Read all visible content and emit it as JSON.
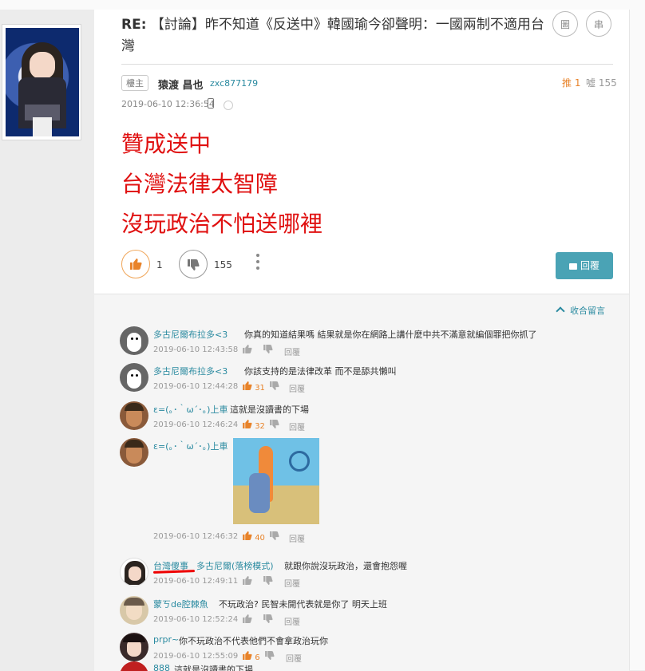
{
  "post": {
    "title_prefix": "RE:",
    "title_text": "【討論】昨不知道《反送中》韓國瑜今卻聲明：一國兩制不適用台灣",
    "image_button": "圖",
    "thread_button": "串",
    "floor_tag": "樓主",
    "author_name": "猿渡 昌也",
    "author_id": "zxc877179",
    "push_label": "推 1",
    "boo_label": "噓 155",
    "time": "2019-06-10 12:36:54",
    "body_lines": [
      "贊成送中",
      "台灣法律太智障",
      "沒玩政治不怕送哪裡"
    ],
    "upvotes": "1",
    "downvotes": "155",
    "reply_button": "回覆"
  },
  "comments_section": {
    "collapse_label": "收合留言",
    "reply_label": "回覆",
    "comments": [
      {
        "user": "多古尼爾布拉多<3",
        "text": "你真的知道結果嗎 結果就是你在網路上講什麼中共不滿意就編個罪把你抓了",
        "time": "2019-06-10 12:43:58",
        "likes": ""
      },
      {
        "user": "多古尼爾布拉多<3",
        "text": "你該支持的是法律改革 而不是舔共懶叫",
        "time": "2019-06-10 12:44:28",
        "likes": "31"
      },
      {
        "user": "ε=(｡･｀ω´･｡)上車",
        "text": "這就是沒讀書的下場",
        "time": "2019-06-10 12:46:24",
        "likes": "32"
      },
      {
        "user": "ε=(｡･｀ω´･｡)上車",
        "text": "",
        "time": "2019-06-10 12:46:32",
        "likes": "40"
      },
      {
        "user": "台灣傻事",
        "user2": "多古尼爾(落榜模式)",
        "text": "就跟你說沒玩政治，還會抱怨喔",
        "time": "2019-06-10 12:49:11",
        "likes": ""
      },
      {
        "user": "蒙ㄎde腔棘魚",
        "text": "不玩政治? 民智未開代表就是你了 明天上班",
        "time": "2019-06-10 12:52:24",
        "likes": ""
      },
      {
        "user": "prpr~",
        "text": "你不玩政治不代表他們不會拿政治玩你",
        "time": "2019-06-10 12:55:09",
        "likes": "6"
      },
      {
        "user": "888",
        "text": "這就是沒讀書的下場",
        "time": "",
        "likes": ""
      }
    ]
  },
  "colors": {
    "accent": "#4aa3b5",
    "link": "#2a8aa0",
    "body_red": "#e01010",
    "like_orange": "#e8832a"
  }
}
